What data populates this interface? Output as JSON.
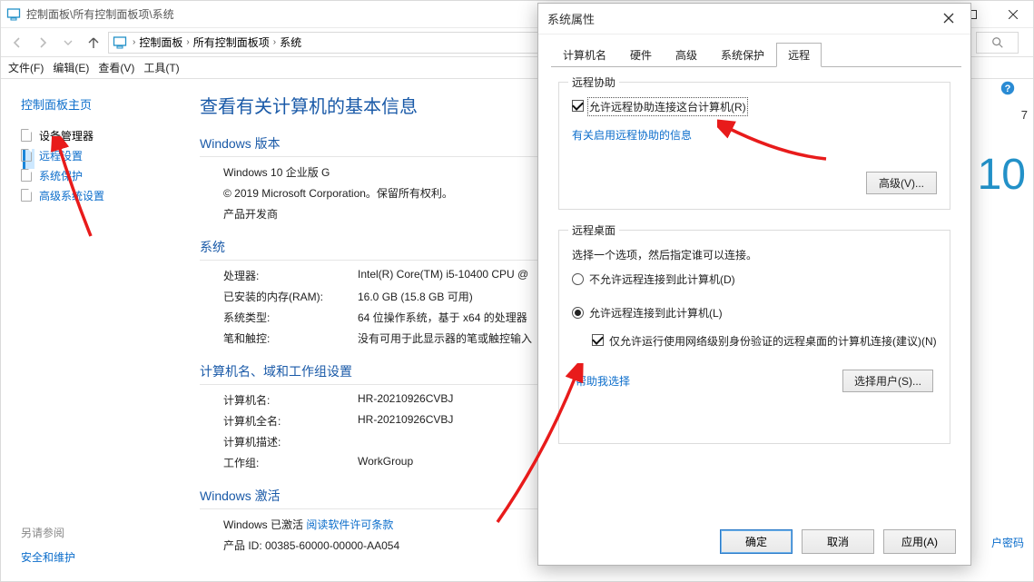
{
  "cp": {
    "title": "控制面板\\所有控制面板项\\系统",
    "breadcrumb": [
      "控制面板",
      "所有控制面板项",
      "系统"
    ],
    "menu": {
      "file": "文件(F)",
      "edit": "编辑(E)",
      "view": "查看(V)",
      "tools": "工具(T)"
    },
    "sidebar": {
      "home": "控制面板主页",
      "links": [
        {
          "label": "设备管理器"
        },
        {
          "label": "远程设置"
        },
        {
          "label": "系统保护"
        },
        {
          "label": "高级系统设置"
        }
      ],
      "see_also": "另请参阅",
      "security": "安全和维护"
    },
    "main": {
      "heading": "查看有关计算机的基本信息",
      "winver_h": "Windows 版本",
      "winver": "Windows 10 企业版 G",
      "copyright": "© 2019 Microsoft Corporation。保留所有权利。",
      "dev": "产品开发商",
      "sys_h": "系统",
      "cpu_k": "处理器:",
      "cpu_v": "Intel(R) Core(TM) i5-10400 CPU @",
      "ram_k": "已安装的内存(RAM):",
      "ram_v": "16.0 GB (15.8 GB 可用)",
      "type_k": "系统类型:",
      "type_v": "64 位操作系统，基于 x64 的处理器",
      "pen_k": "笔和触控:",
      "pen_v": "没有可用于此显示器的笔或触控输入",
      "dom_h": "计算机名、域和工作组设置",
      "pc_k": "计算机名:",
      "pc_v": "HR-20210926CVBJ",
      "pcf_k": "计算机全名:",
      "pcf_v": "HR-20210926CVBJ",
      "desc_k": "计算机描述:",
      "desc_v": "",
      "wg_k": "工作组:",
      "wg_v": "WorkGroup",
      "act_h": "Windows 激活",
      "act_txt": "Windows 已激活 ",
      "act_link": "阅读软件许可条款",
      "pid": "产品 ID: 00385-60000-00000-AA054"
    }
  },
  "edge": {
    "ten": "10",
    "seven": "7",
    "pw": "户密码"
  },
  "dlg": {
    "title": "系统属性",
    "tabs": [
      "计算机名",
      "硬件",
      "高级",
      "系统保护",
      "远程"
    ],
    "assist": {
      "title": "远程协助",
      "chk": "允许远程协助连接这台计算机(R)",
      "link": "有关启用远程协助的信息",
      "adv_btn": "高级(V)..."
    },
    "rdp": {
      "title": "远程桌面",
      "hint": "选择一个选项，然后指定谁可以连接。",
      "r1": "不允许远程连接到此计算机(D)",
      "r2": "允许远程连接到此计算机(L)",
      "nla": "仅允许运行使用网络级别身份验证的远程桌面的计算机连接(建议)(N)",
      "help": "帮助我选择",
      "sel_btn": "选择用户(S)..."
    },
    "footer": {
      "ok": "确定",
      "cancel": "取消",
      "apply": "应用(A)"
    }
  }
}
